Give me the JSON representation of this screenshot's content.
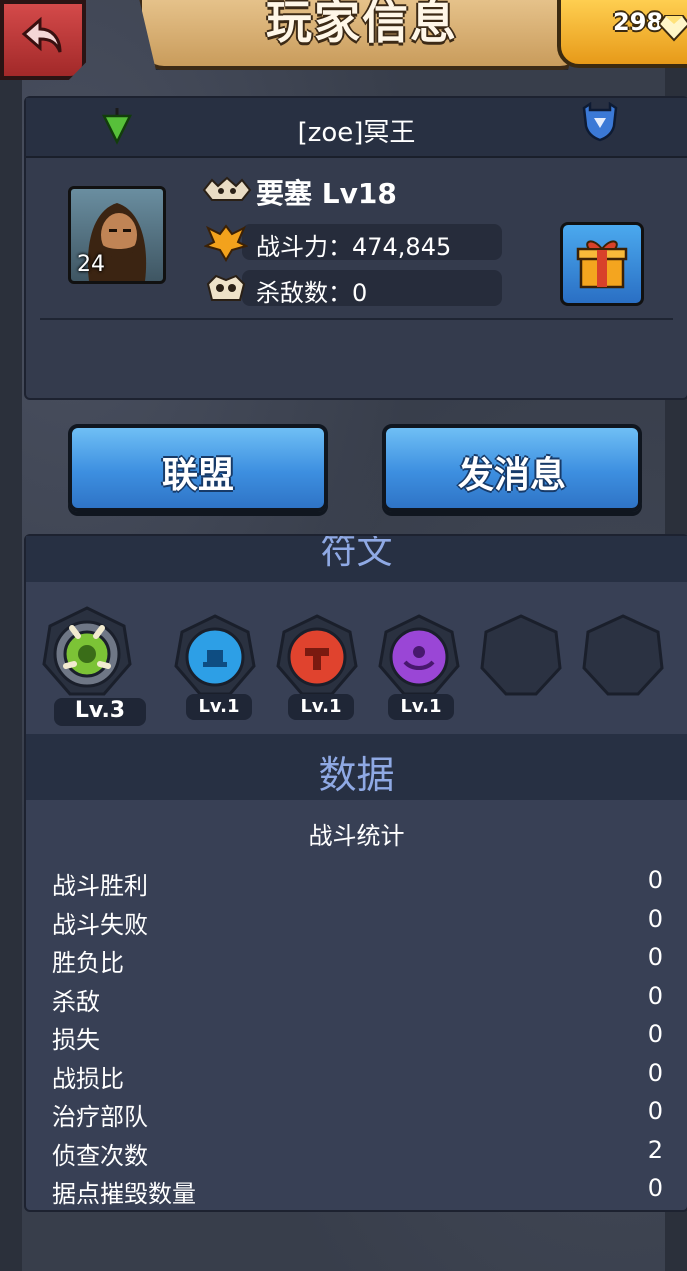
{
  "header": {
    "title": "玩家信息",
    "gems": "298",
    "back_icon": "back-arrow-icon"
  },
  "player": {
    "name": "[zoe]冥王",
    "avatar_level": "24",
    "fortress": "要塞 Lv18",
    "power_label": "战斗力：474,845",
    "kills_label": "杀敌数：0"
  },
  "actions": {
    "alliance": "联盟",
    "message": "发消息"
  },
  "runes": {
    "title": "符文",
    "levels": [
      "Lv.3",
      "Lv.1",
      "Lv.1",
      "Lv.1"
    ],
    "colors": [
      "#7cc336",
      "#2d9fe6",
      "#e0432e",
      "#9a46d6"
    ]
  },
  "data": {
    "title": "数据",
    "subtitle": "战斗统计",
    "rows": [
      {
        "label": "战斗胜利",
        "value": "0"
      },
      {
        "label": "战斗失败",
        "value": "0"
      },
      {
        "label": "胜负比",
        "value": "0"
      },
      {
        "label": "杀敌",
        "value": "0"
      },
      {
        "label": "损失",
        "value": "0"
      },
      {
        "label": "战损比",
        "value": "0"
      },
      {
        "label": "治疗部队",
        "value": "0"
      },
      {
        "label": "侦查次数",
        "value": "2"
      },
      {
        "label": "据点摧毁数量",
        "value": "0"
      }
    ]
  }
}
